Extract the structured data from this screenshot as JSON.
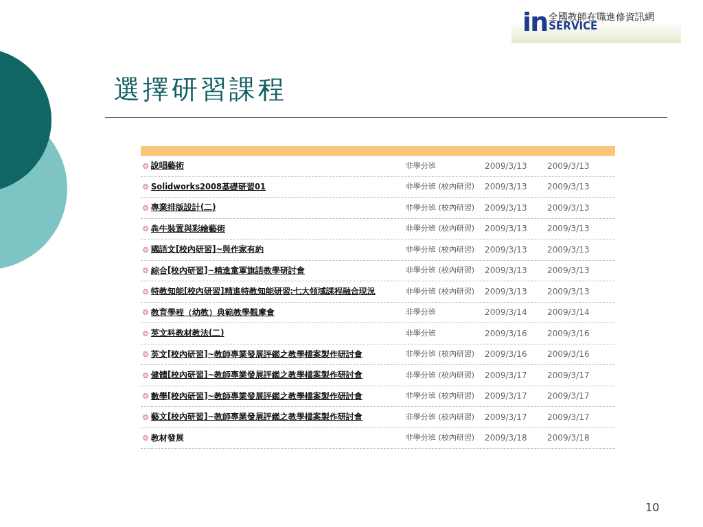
{
  "logo": {
    "mark": "in",
    "name": "全國教師在職進修資訊網",
    "sub": "SERVICE"
  },
  "title": "選擇研習課程",
  "courses": [
    {
      "title": "說唱藝術",
      "link": true,
      "type": "非學分班",
      "start": "2009/3/13",
      "end": "2009/3/13"
    },
    {
      "title": "Solidworks2008基礎研習01",
      "link": true,
      "type": "非學分班 (校內研習)",
      "start": "2009/3/13",
      "end": "2009/3/13"
    },
    {
      "title": "專業排版設計(二)",
      "link": true,
      "type": "非學分班 (校內研習)",
      "start": "2009/3/13",
      "end": "2009/3/13"
    },
    {
      "title": "犇牛裝置與彩繪藝術",
      "link": true,
      "type": "非學分班 (校內研習)",
      "start": "2009/3/13",
      "end": "2009/3/13"
    },
    {
      "title": "國語文[校內研習]~與作家有約",
      "link": true,
      "type": "非學分班 (校內研習)",
      "start": "2009/3/13",
      "end": "2009/3/13"
    },
    {
      "title": "綜合[校內研習]~精進童軍旗語教學研討會",
      "link": true,
      "type": "非學分班 (校內研習)",
      "start": "2009/3/13",
      "end": "2009/3/13"
    },
    {
      "title": "特教知能[校內研習]精進特教知能研習:七大領域課程融合現況",
      "link": true,
      "type": "非學分班 (校內研習)",
      "start": "2009/3/13",
      "end": "2009/3/13"
    },
    {
      "title": "教育學程（幼教）典範教學觀摩會",
      "link": true,
      "type": "非學分班",
      "start": "2009/3/14",
      "end": "2009/3/14"
    },
    {
      "title": "英文科教材教法(二)",
      "link": true,
      "type": "非學分班",
      "start": "2009/3/16",
      "end": "2009/3/16"
    },
    {
      "title": "英文[校內研習]~教師專業發展評鑑之教學檔案製作研討會",
      "link": true,
      "type": "非學分班 (校內研習)",
      "start": "2009/3/16",
      "end": "2009/3/16"
    },
    {
      "title": "健體[校內研習]~教師專業發展評鑑之教學檔案製作研討會",
      "link": true,
      "type": "非學分班 (校內研習)",
      "start": "2009/3/17",
      "end": "2009/3/17"
    },
    {
      "title": "數學[校內研習]~教師專業發展評鑑之教學檔案製作研討會",
      "link": true,
      "type": "非學分班 (校內研習)",
      "start": "2009/3/17",
      "end": "2009/3/17"
    },
    {
      "title": "藝文[校內研習]~教師專業發展評鑑之教學檔案製作研討會",
      "link": true,
      "type": "非學分班 (校內研習)",
      "start": "2009/3/17",
      "end": "2009/3/17"
    },
    {
      "title": "教材發展",
      "link": false,
      "type": "非學分班 (校內研習)",
      "start": "2009/3/18",
      "end": "2009/3/18"
    }
  ],
  "page_number": "10"
}
